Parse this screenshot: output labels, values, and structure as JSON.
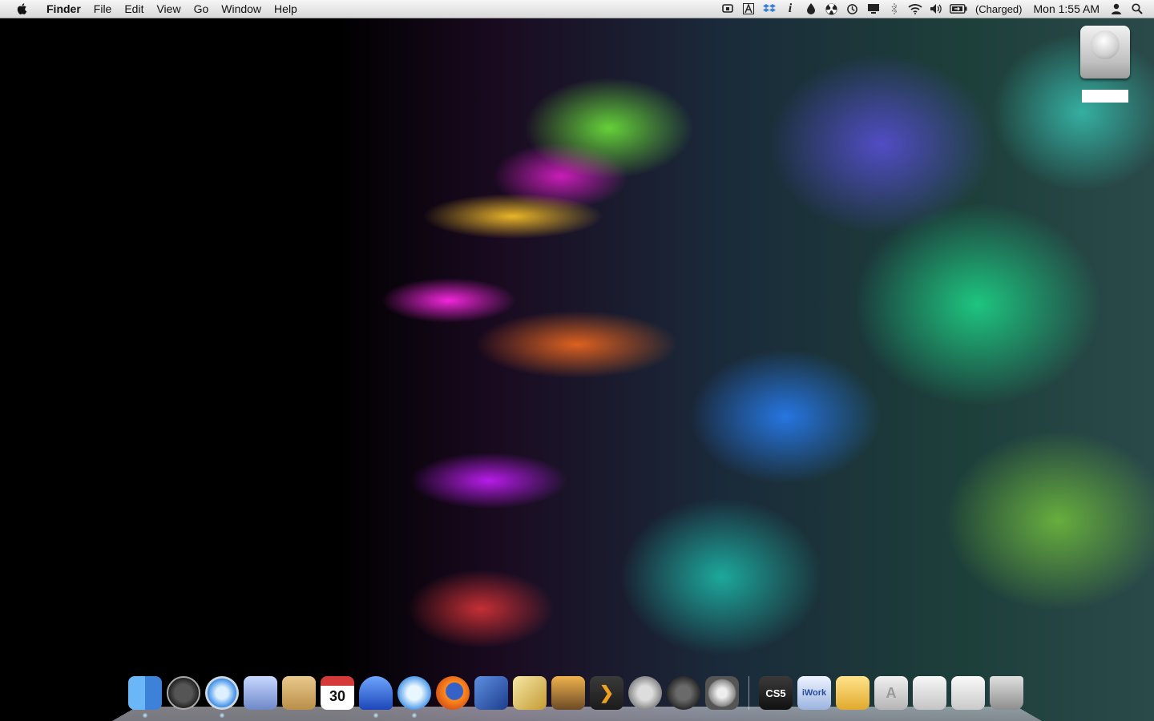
{
  "menubar": {
    "app_name": "Finder",
    "menus": [
      "File",
      "Edit",
      "View",
      "Go",
      "Window",
      "Help"
    ],
    "battery_status": "(Charged)",
    "clock": "Mon 1:55 AM",
    "status_icons": [
      "rdp-icon",
      "font-icon",
      "dropbox-icon",
      "info-icon",
      "droplet-icon",
      "radiation-icon",
      "time-machine-icon",
      "display-icon",
      "bluetooth-icon",
      "wifi-icon",
      "volume-icon",
      "battery-icon",
      "user-icon",
      "spotlight-icon"
    ]
  },
  "desktop": {
    "drive_label": ""
  },
  "dock": {
    "items": [
      {
        "name": "finder"
      },
      {
        "name": "dashboard"
      },
      {
        "name": "safari"
      },
      {
        "name": "mail"
      },
      {
        "name": "address-book"
      },
      {
        "name": "ical",
        "text": "30"
      },
      {
        "name": "ichat"
      },
      {
        "name": "itunes"
      },
      {
        "name": "firefox"
      },
      {
        "name": "xcode"
      },
      {
        "name": "developer-tools"
      },
      {
        "name": "iphoto"
      },
      {
        "name": "plex",
        "text": "❯"
      },
      {
        "name": "airplane-app"
      },
      {
        "name": "steam"
      },
      {
        "name": "system-preferences"
      },
      {
        "name": "adobe-cs5",
        "text": "CS5"
      },
      {
        "name": "iwork",
        "text": "iWork"
      },
      {
        "name": "folder-yellow"
      },
      {
        "name": "applications-folder",
        "text": "A"
      },
      {
        "name": "documents-folder"
      },
      {
        "name": "downloads-stack"
      },
      {
        "name": "trash"
      }
    ]
  },
  "colors": {
    "menubar_top": "#f6f6f6",
    "menubar_bottom": "#d9d9d9",
    "desktop_background": "#000000"
  }
}
